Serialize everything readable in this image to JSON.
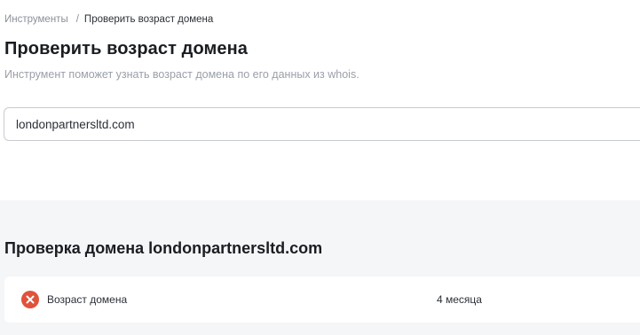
{
  "breadcrumb": {
    "parent": "Инструменты",
    "separator": "/",
    "current": "Проверить возраст домена"
  },
  "page": {
    "title": "Проверить возраст домена",
    "subtitle": "Инструмент поможет узнать возраст домена по его данных из whois."
  },
  "domain_input": {
    "value": "londonpartnersltd.com"
  },
  "results": {
    "title": "Проверка домена londonpartnersltd.com",
    "rows": [
      {
        "status_icon": "error-x-icon",
        "status_color": "#e0523a",
        "label": "Возраст домена",
        "value": "4 месяца"
      }
    ]
  }
}
